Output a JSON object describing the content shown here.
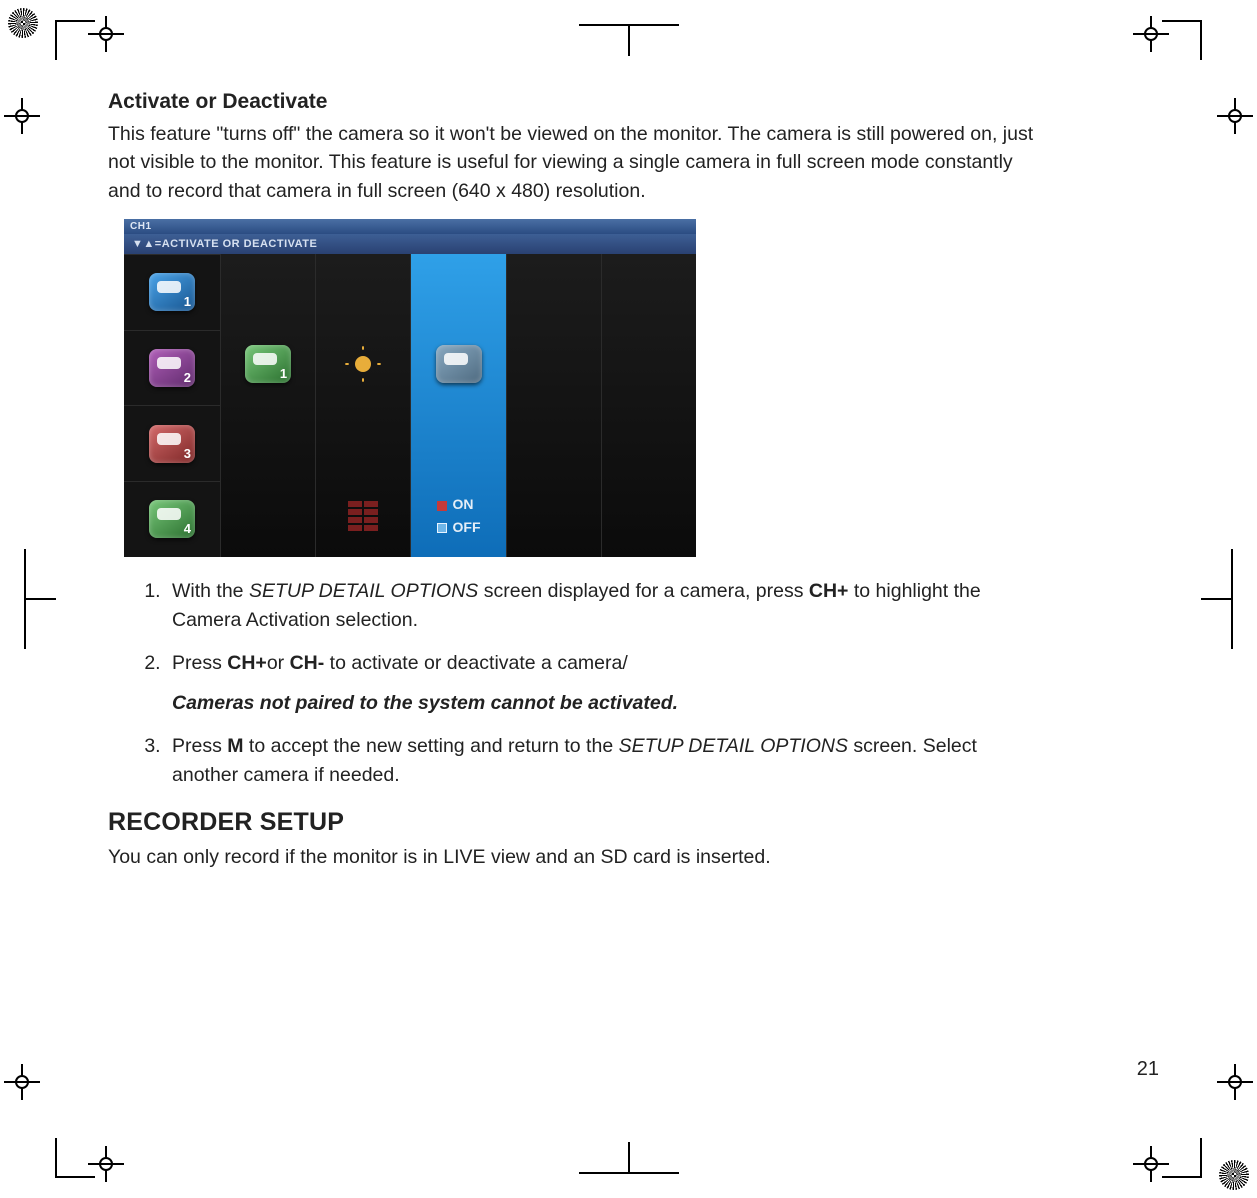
{
  "heading": "Activate or Deactivate",
  "intro": "This feature \"turns off\" the camera so it won't be viewed on the monitor. The camera is still powered on, just not visible to the monitor. This feature is useful for viewing a single camera in full screen mode constantly and to record that camera in full screen (640 x 480) resolution.",
  "device": {
    "title": "CH1",
    "hint": "▼▲=ACTIVATE OR DEACTIVATE",
    "cams": [
      "1",
      "2",
      "3",
      "4"
    ],
    "on": "ON",
    "off": "OFF"
  },
  "steps": {
    "s1_a": "With the ",
    "s1_b": "SETUP DETAIL OPTIONS",
    "s1_c": " screen displayed for a camera, press ",
    "s1_d": "CH+",
    "s1_e": " to highlight the Camera Activation selection.",
    "s2_a": "Press ",
    "s2_b": "CH+",
    "s2_c": "or ",
    "s2_d": "CH-",
    "s2_e": " to activate or deactivate a camera/",
    "s2_note": "Cameras not paired to the system cannot be activated.",
    "s3_a": "Press ",
    "s3_b": "M",
    "s3_c": " to accept the new setting and return to the ",
    "s3_d": "SETUP DETAIL OPTIONS",
    "s3_e": " screen. Select another camera if needed."
  },
  "section2_heading": "RECORDER SETUP",
  "section2_intro": "You can only record if the monitor is in LIVE view and an SD card is inserted.",
  "page_number": "21"
}
